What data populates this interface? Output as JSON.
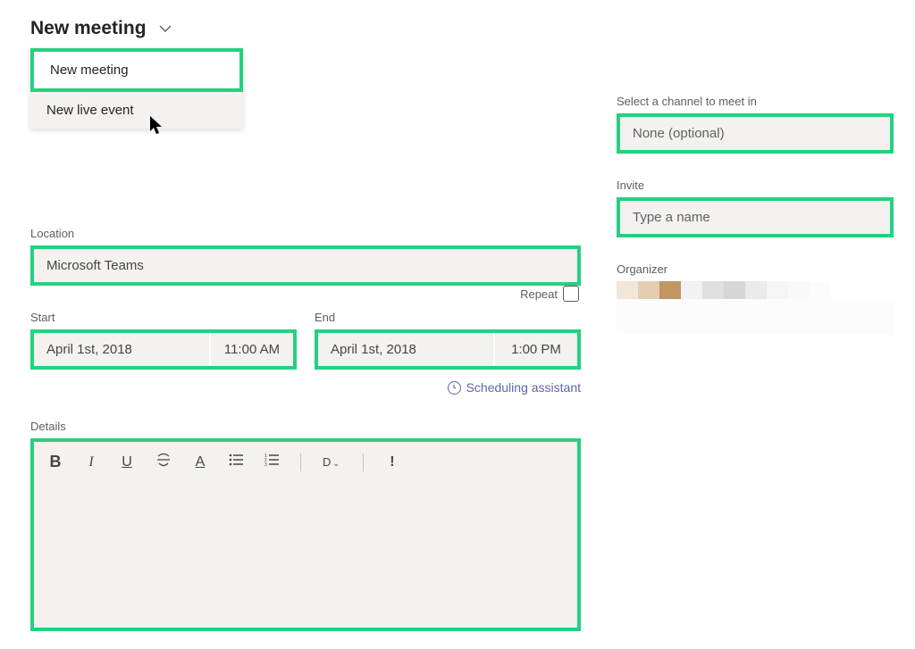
{
  "title": "New meeting",
  "dropdown": {
    "items": [
      "New meeting",
      "New live event"
    ]
  },
  "location": {
    "label": "Location",
    "value": "Microsoft Teams"
  },
  "start": {
    "label": "Start",
    "date": "April 1st, 2018",
    "time": "11:00 AM"
  },
  "end": {
    "label": "End",
    "date": "April 1st, 2018",
    "time": "1:00 PM"
  },
  "repeat_label": "Repeat",
  "scheduling_assistant": "Scheduling assistant",
  "details_label": "Details",
  "toolbar": {
    "bold": "B",
    "italic": "I",
    "underline": "U",
    "strike": "∀",
    "fontcolor": "A",
    "bullet": "≡",
    "number": "≡",
    "para": "D",
    "important": "!"
  },
  "channel": {
    "label": "Select a channel to meet in",
    "placeholder": "None (optional)"
  },
  "invite": {
    "label": "Invite",
    "placeholder": "Type a name"
  },
  "organizer_label": "Organizer"
}
